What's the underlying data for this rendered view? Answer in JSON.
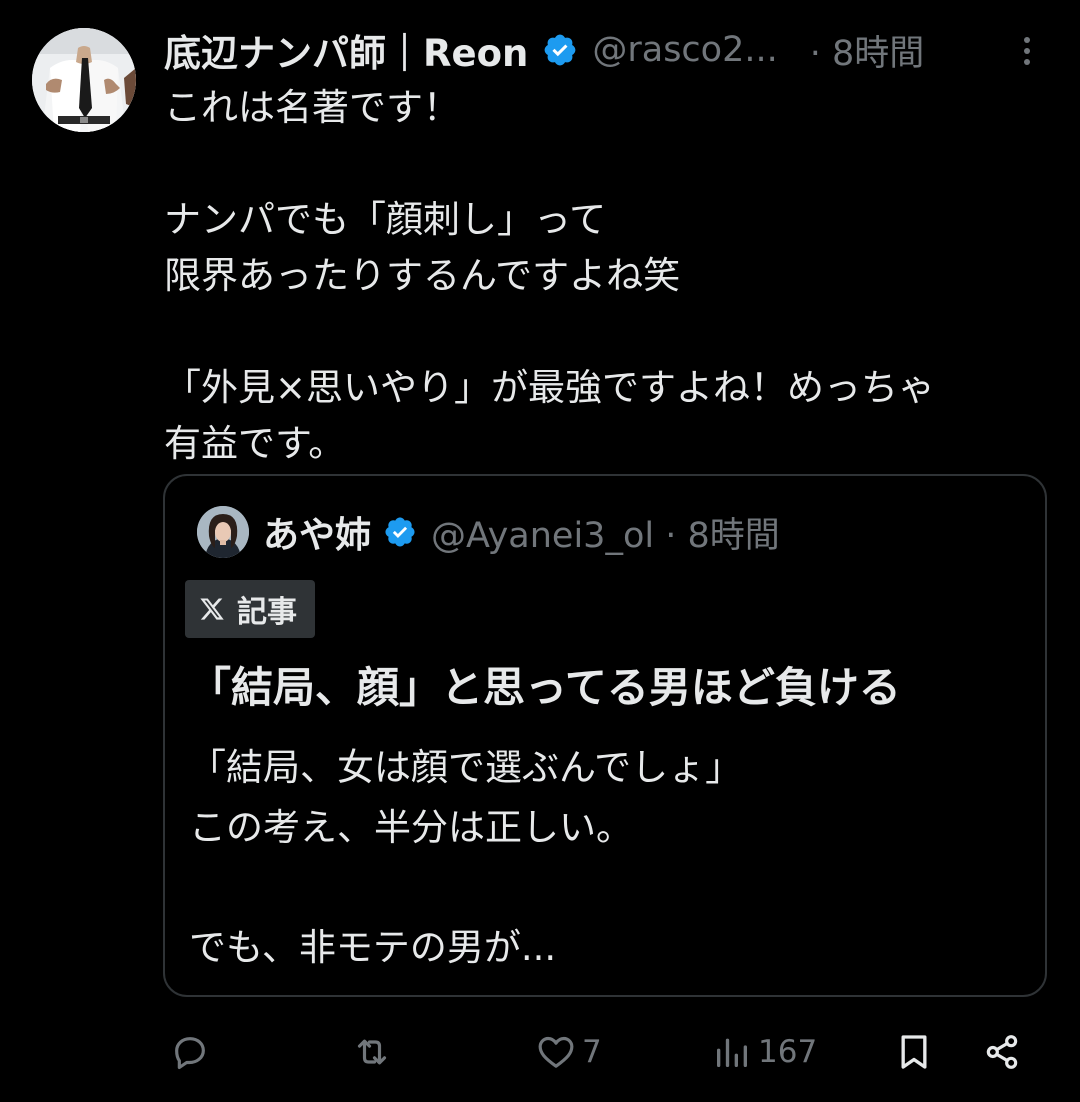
{
  "tweet": {
    "author": {
      "name": "底辺ナンパ師｜Reon",
      "handle": "@rasco2...",
      "time": "· 8時間",
      "avatar_icon": "avatar-man-in-suit",
      "verified_icon": "verified-badge-icon"
    },
    "more_icon": "more-vertical-icon",
    "body_lines": [
      "これは名著です！",
      "",
      "ナンパでも「顔刺し」って",
      "限界あったりするんですよね笑",
      "",
      "「外見×思いやり」が最強ですよね！めっちゃ",
      "有益です。"
    ],
    "quote": {
      "author": {
        "name": "あや姉",
        "handle": "@Ayanei3_ol · 8時間",
        "avatar_icon": "avatar-woman",
        "verified_icon": "verified-badge-icon"
      },
      "badge": {
        "icon": "x-logo-icon",
        "label": "記事"
      },
      "title": "「結局、顔」と思ってる男ほど負ける",
      "text_lines": [
        "「結局、女は顔で選ぶんでしょ」",
        "この考え、半分は正しい。",
        "",
        "でも、非モテの男が..."
      ]
    },
    "actions": {
      "reply": {
        "icon": "reply-icon",
        "count": ""
      },
      "retweet": {
        "icon": "retweet-icon",
        "count": ""
      },
      "like": {
        "icon": "heart-icon",
        "count": "7"
      },
      "views": {
        "icon": "views-icon",
        "count": "167"
      },
      "bookmark": {
        "icon": "bookmark-icon",
        "count": ""
      },
      "share": {
        "icon": "share-icon",
        "count": ""
      }
    },
    "colors": {
      "background": "#000000",
      "text": "#e7e9ea",
      "secondary": "#71767b",
      "verified": "#1d9bf0",
      "border": "#2f3336"
    }
  }
}
